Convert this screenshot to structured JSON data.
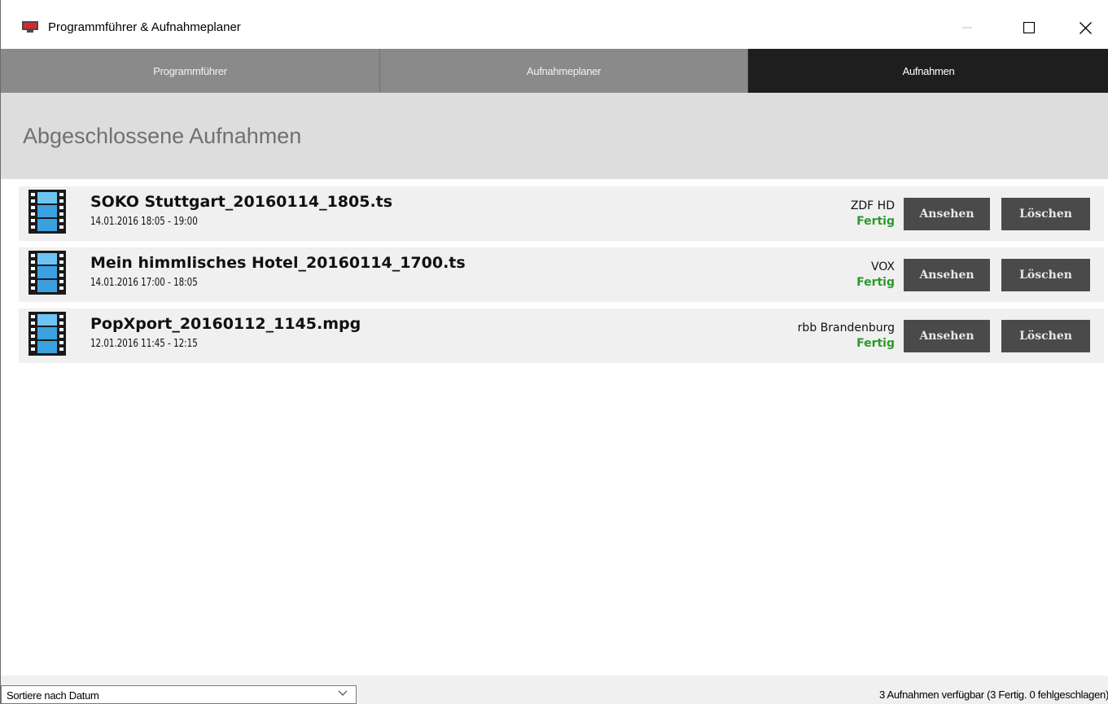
{
  "window": {
    "title": "Programmführer & Aufnahmeplaner"
  },
  "tabs": [
    {
      "label": "Programmführer",
      "active": false
    },
    {
      "label": "Aufnahmeplaner",
      "active": false
    },
    {
      "label": "Aufnahmen",
      "active": true
    }
  ],
  "section": {
    "title": "Abgeschlossene Aufnahmen"
  },
  "recordings": [
    {
      "name": "SOKO Stuttgart_20160114_1805.ts",
      "time": "14.01.2016 18:05 - 19:00",
      "channel": "ZDF HD",
      "status": "Fertig",
      "view_label": "Ansehen",
      "delete_label": "Löschen",
      "icon": "film-icon"
    },
    {
      "name": "Mein himmlisches Hotel_20160114_1700.ts",
      "time": "14.01.2016 17:00 - 18:05",
      "channel": "VOX",
      "status": "Fertig",
      "view_label": "Ansehen",
      "delete_label": "Löschen",
      "icon": "film-icon"
    },
    {
      "name": "PopXport_20160112_1145.mpg",
      "time": "12.01.2016 11:45 - 12:15",
      "channel": "rbb Brandenburg",
      "status": "Fertig",
      "view_label": "Ansehen",
      "delete_label": "Löschen",
      "icon": "film-icon"
    }
  ],
  "statusbar": {
    "sort_value": "Sortiere nach Datum",
    "summary": "3 Aufnahmen verfügbar  (3 Fertig. 0 fehlgeschlagen)"
  },
  "colors": {
    "tab_inactive": "#8a8a8a",
    "tab_active": "#1e1e1e",
    "status_done": "#2a9a2a",
    "button_bg": "#4a4a4a"
  }
}
